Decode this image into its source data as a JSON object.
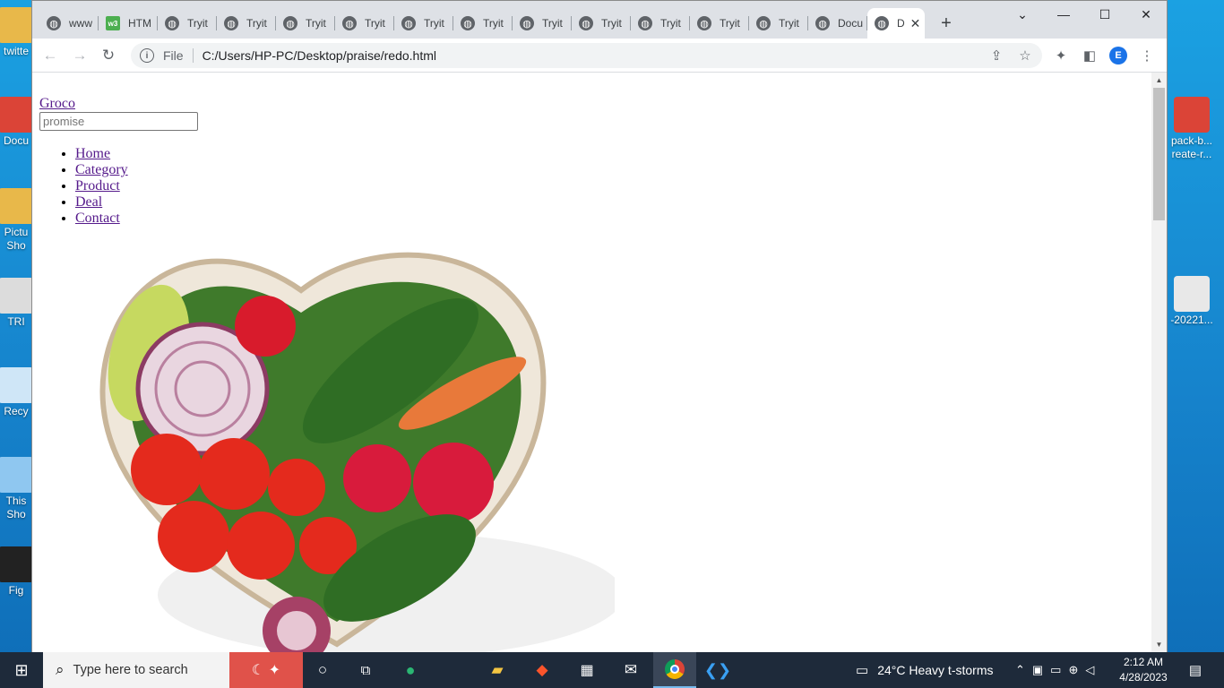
{
  "desktop": {
    "icons": [
      {
        "label": "twitte",
        "color": "#e8b84a"
      },
      {
        "label": "Docu",
        "color": "#db4437"
      },
      {
        "label": "Pictu",
        "sub": "Sho",
        "color": "#e8b84a"
      },
      {
        "label": "TRI",
        "color": "#dcdcdc"
      },
      {
        "label": "Recy",
        "color": "#cfe6f7"
      },
      {
        "label": "This",
        "sub": "Sho",
        "color": "#8fc7f0"
      },
      {
        "label": "Fig",
        "color": "#222222"
      }
    ],
    "right_icons": [
      {
        "label": "pack-b...",
        "sub": "reate-r...",
        "color": "#db4437"
      },
      {
        "label": "-20221...",
        "color": "#e8e8e8"
      }
    ]
  },
  "browser": {
    "tabs": [
      {
        "title": "www",
        "icon": "globe"
      },
      {
        "title": "HTM",
        "icon": "w3"
      },
      {
        "title": "Tryit",
        "icon": "globe"
      },
      {
        "title": "Tryit",
        "icon": "globe"
      },
      {
        "title": "Tryit",
        "icon": "globe"
      },
      {
        "title": "Tryit",
        "icon": "globe"
      },
      {
        "title": "Tryit",
        "icon": "globe"
      },
      {
        "title": "Tryit",
        "icon": "globe"
      },
      {
        "title": "Tryit",
        "icon": "globe"
      },
      {
        "title": "Tryit",
        "icon": "globe"
      },
      {
        "title": "Tryit",
        "icon": "globe"
      },
      {
        "title": "Tryit",
        "icon": "globe"
      },
      {
        "title": "Tryit",
        "icon": "globe"
      },
      {
        "title": "Docu",
        "icon": "globe"
      }
    ],
    "active_tab": {
      "title": "D",
      "icon": "globe"
    },
    "new_tab": "+",
    "omnibox": {
      "scheme_label": "File",
      "url": "C:/Users/HP-PC/Desktop/praise/redo.html"
    },
    "profile_initial": "E"
  },
  "page": {
    "logo": "Groco",
    "search_placeholder": "promise",
    "nav": [
      "Home",
      "Category",
      "Product",
      "Deal",
      "Contact"
    ]
  },
  "taskbar": {
    "search_placeholder": "Type here to search",
    "weather": "24°C  Heavy t-storms",
    "time": "2:12 AM",
    "date": "4/28/2023"
  }
}
